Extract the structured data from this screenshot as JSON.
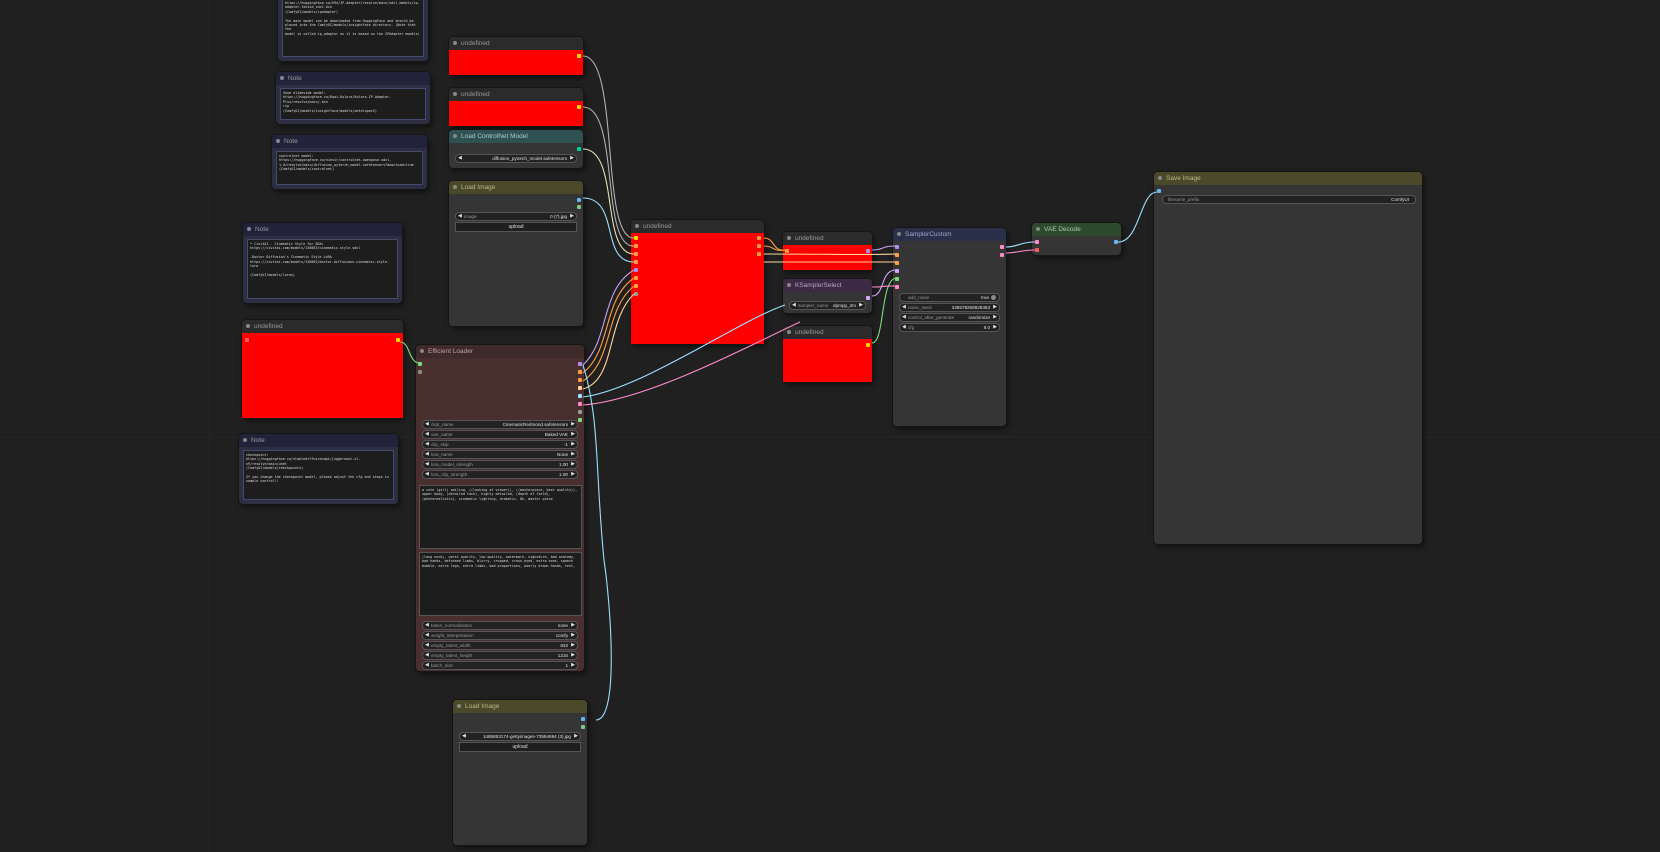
{
  "nodes": {
    "top_note_text": "https://huggingface.co/h94/IP-Adapter/resolve/main/sdxl_models/ip-\nadapter-faceid_sdxl.bin\n(ComfyUI/models/ipadapter)\n\nThe main model can be downloaded from HuggingFace and should be\nplaced into the ComfyUI/models/insightface directory. (Note that the\nmodel is called ip_adapter as it is based on the IPAdapter models)",
    "note2": {
      "title": "Note",
      "text": "Save alidevide model:\nhttps://huggingface.co/Kwai-Kolors/Kolors-IP-Adapter-Plus/resolve/main/.bin\nrip\n(ComfyUI/models/insightface/models/antelopev2)"
    },
    "note3": {
      "title": "Note",
      "text": "controlnet model:\nhttps://huggingface.co/xinsir/controlnet-openpose-sdxl-1.0/resolve/main/diffusion_pytorch_model.safetensors?download=true\n(ComfyUI/models/controlnet)"
    },
    "note4": {
      "title": "Note",
      "text": "* CivitAI - Cinematic Style for SDXL\nhttps://civitai.com/models/130003/cinematic-style-sdxl\n\n-Doctor Diffusion's Cinematic Style LoRA\nhttps://civitai.com/models/130003/doctor-diffusions-cinematic-style-lora\n\n(ComfyUI/models/loras)"
    },
    "note5": {
      "title": "Note",
      "text": "checkpoint:\nhttps://huggingface.co/stablediffusionapi/juggernaut-xl-v9/resolve/main/unet\n(ComfyUI/models/checkpoints)\n\nIf you change the checkpoint model, please adjust the cfg and steps in\nsample control!!"
    },
    "undef_a": {
      "title": "undefined"
    },
    "undef_b": {
      "title": "undefined"
    },
    "controlnet": {
      "title": "Load ControlNet Model",
      "widget_value": "diffusion_pytorch_model.safetensors"
    },
    "load_image1": {
      "title": "Load Image",
      "image_label": "image",
      "image_value": "0 (7).jpg",
      "upload": "upload"
    },
    "undef_left": {
      "title": "undefined"
    },
    "undef_center": {
      "title": "undefined"
    },
    "efficient": {
      "title": "Efficient Loader",
      "widgets": [
        {
          "label": "ckpt_name",
          "value": "CinematicRedmond.safetensors"
        },
        {
          "label": "vae_name",
          "value": "Baked VAE"
        },
        {
          "label": "clip_skip",
          "value": "-1"
        },
        {
          "label": "lora_name",
          "value": "None"
        },
        {
          "label": "lora_model_strength",
          "value": "1.00"
        },
        {
          "label": "lora_clip_strength",
          "value": "1.00"
        }
      ],
      "positive": "a cute (girl) smiling, ((looking at viewer)), ((masterpiece, best quality)), upper body, (detailed face), highly detailed, (depth of field), (photorealistic), cinematic lighting, dramatic, 8k, master piece",
      "negative": "(long neck), worst quality, low quality, watermark, signature, bad anatomy, bad hands, deformed limbs, blurry, cropped, cross-eyed, extra arms, speech bubble, extra legs, extra limbs, bad proportions, poorly drawn hands, text,",
      "widgets2": [
        {
          "label": "token_normalization",
          "value": "none"
        },
        {
          "label": "weight_interpretation",
          "value": "comfy"
        },
        {
          "label": "empty_latent_width",
          "value": "832"
        },
        {
          "label": "empty_latent_height",
          "value": "1216"
        },
        {
          "label": "batch_size",
          "value": "1"
        }
      ]
    },
    "undef_r1": {
      "title": "undefined"
    },
    "ksampler_select": {
      "title": "KSamplerSelect",
      "widget_label": "sampler_name",
      "widget_value": "dpmpp_2m"
    },
    "undef_r2": {
      "title": "undefined"
    },
    "sampler_custom": {
      "title": "SamplerCustom",
      "widgets": [
        {
          "label": "add_noise",
          "value": "true"
        },
        {
          "label": "noise_seed",
          "value": "339579269928363"
        },
        {
          "label": "control_after_generate",
          "value": "randomize"
        },
        {
          "label": "cfg",
          "value": "8.0"
        }
      ]
    },
    "vae_decode": {
      "title": "VAE Decode"
    },
    "save_image": {
      "title": "Save Image",
      "widget_label": "filename_prefix",
      "widget_value": "ComfyUI"
    },
    "load_image2": {
      "title": "Load Image",
      "image_value": "1488853174-gettyimages-73594694 (3).jpg",
      "upload": "upload"
    }
  },
  "colors": {
    "canvas": "#202020",
    "node_body": "#353535",
    "note_body": "#2e2e42",
    "controlnet_title": "#2f5151",
    "load_image_title": "#4a4a2a",
    "efficient_body": "#4a2f2f",
    "efficient_title": "#3f2a2a",
    "ksampler_title": "#3c2a45",
    "sampler_title": "#2a2f4a",
    "vae_title": "#2e4a2e",
    "save_title": "#4a4a2a",
    "error_fill": "#ff0000"
  }
}
